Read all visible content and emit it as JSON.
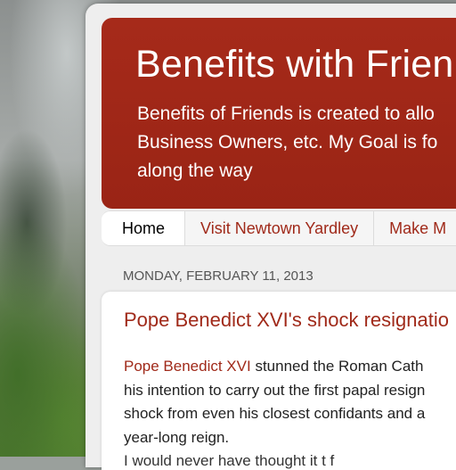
{
  "header": {
    "title": "Benefits with Frien",
    "description_lines": [
      "Benefits of Friends is created to allo",
      "Business Owners, etc. My Goal is fo",
      "along the way"
    ]
  },
  "tabs": [
    {
      "label": "Home",
      "active": true
    },
    {
      "label": "Visit Newtown Yardley",
      "active": false
    },
    {
      "label": "Make M",
      "active": false
    }
  ],
  "date_header": "MONDAY, FEBRUARY 11, 2013",
  "post": {
    "title": "Pope Benedict XVI's shock resignatio",
    "link_text": "Pope Benedict XVI",
    "line1_rest": " stunned the Roman Cath",
    "lines": [
      "his intention to carry out the first papal resign",
      "shock from even his closest confidants and a",
      "year-long reign."
    ],
    "partial_line": "I would never have thought it t f"
  },
  "colors": {
    "header_bg": "#9d2516",
    "link": "#a02a1a",
    "content_bg": "#eeeeee"
  }
}
